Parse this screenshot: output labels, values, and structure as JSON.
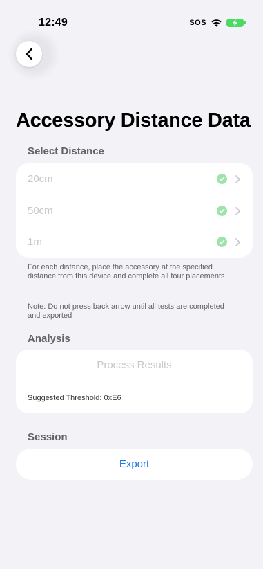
{
  "status_bar": {
    "time": "12:49",
    "sos": "SOS"
  },
  "icons": {
    "back": "chevron-left-icon",
    "wifi": "wifi-icon",
    "battery": "battery-charging-icon",
    "check": "checkmark-circle-icon",
    "chevron": "chevron-right-icon"
  },
  "page": {
    "title": "Accessory Distance Data"
  },
  "select_distance": {
    "header": "Select Distance",
    "items": [
      {
        "label": "20cm",
        "completed": true
      },
      {
        "label": "50cm",
        "completed": true
      },
      {
        "label": "1m",
        "completed": true
      }
    ],
    "instructions": "For each distance, place the accessory at the specified distance from this device and complete all four placements",
    "note": "Note: Do not press back arrow until all tests are completed and exported"
  },
  "analysis": {
    "header": "Analysis",
    "process_label": "Process Results",
    "threshold": "Suggested Threshold: 0xE6"
  },
  "session": {
    "header": "Session",
    "export_label": "Export"
  },
  "colors": {
    "background": "#f2f2f7",
    "card": "#ffffff",
    "accent_blue": "#1a73e8",
    "check_green": "#9ee4aa",
    "battery_green": "#4cd964"
  }
}
